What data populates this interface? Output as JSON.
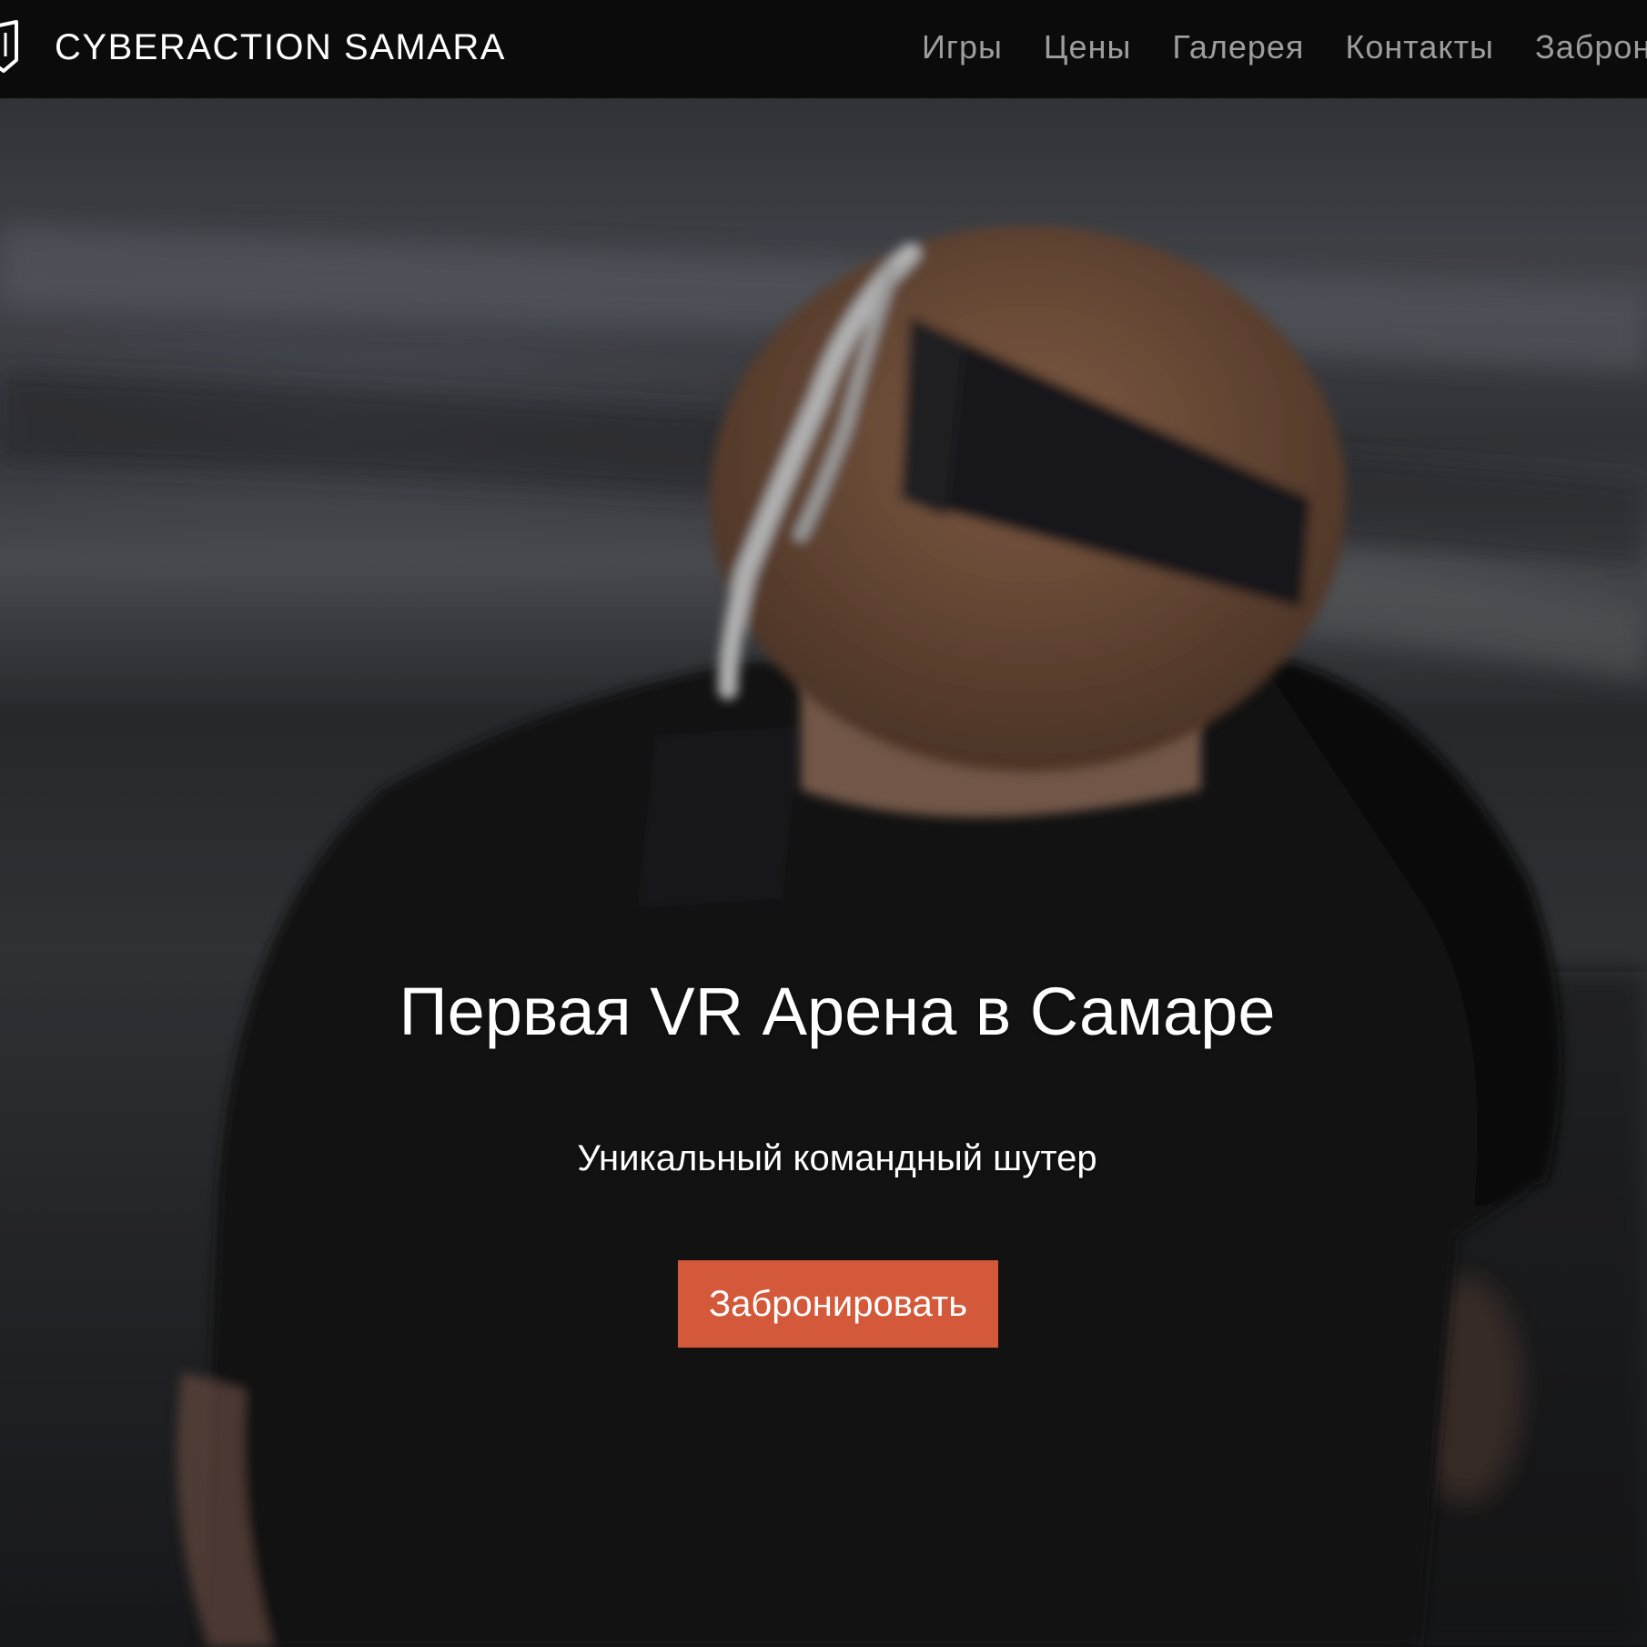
{
  "navbar": {
    "brand": {
      "logo_icon": "shield-outline-icon",
      "name": "CYBERACTION SAMARA"
    },
    "links": [
      {
        "label": "Игры"
      },
      {
        "label": "Цены"
      },
      {
        "label": "Галерея"
      },
      {
        "label": "Контакты"
      },
      {
        "label": "Забронировать"
      }
    ]
  },
  "hero": {
    "background": "photo-vr-player-back-view",
    "title": "Первая VR Арена в Самаре",
    "subtitle": "Уникальный командный шутер",
    "cta_label": "Забронировать"
  },
  "colors": {
    "navbar_bg": "#0b0b0b",
    "nav_link": "#9d9d9d",
    "brand_text": "#ffffff",
    "cta_bg": "#d4593a",
    "hero_text": "#ffffff"
  }
}
